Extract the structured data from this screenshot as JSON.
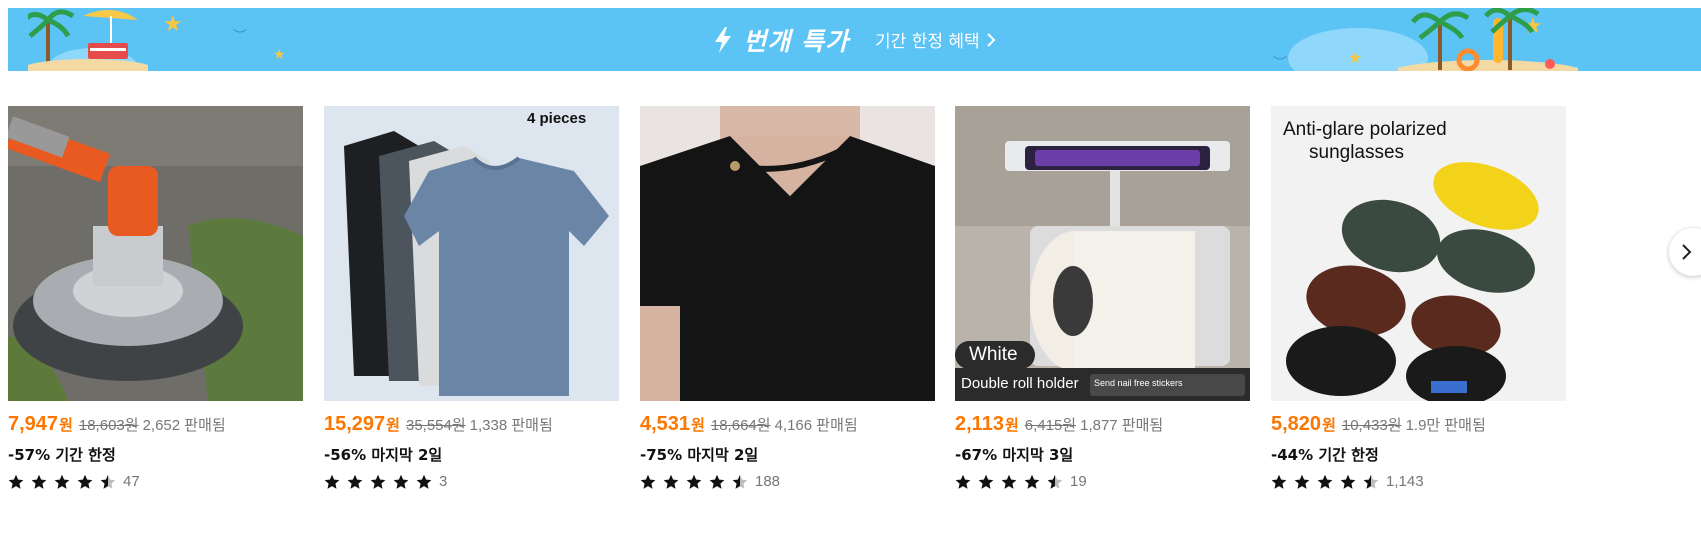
{
  "banner": {
    "title": "번개 특가",
    "subtitle": "기간 한정 혜택",
    "bg_color": "#5cc3f5",
    "icon": "lightning-bolt-icon"
  },
  "products": [
    {
      "price": "7,947",
      "currency": "원",
      "original_price": "18,603원",
      "sold": "2,652 판매됨",
      "promo": "-57% 기간 한정",
      "rating": 4.5,
      "reviews": "47"
    },
    {
      "price": "15,297",
      "currency": "원",
      "original_price": "35,554원",
      "sold": "1,338 판매됨",
      "promo": "-56% 마지막 2일",
      "rating": 5,
      "reviews": "3",
      "image_text": "4 pieces"
    },
    {
      "price": "4,531",
      "currency": "원",
      "original_price": "18,664원",
      "sold": "4,166 판매됨",
      "promo": "-75% 마지막 2일",
      "rating": 4.5,
      "reviews": "188"
    },
    {
      "price": "2,113",
      "currency": "원",
      "original_price": "6,415원",
      "sold": "1,877 판매됨",
      "promo": "-67% 마지막 3일",
      "rating": 4.5,
      "reviews": "19",
      "image_text": "White",
      "image_text2": "Double roll holder",
      "image_text3": "Send nail free stickers"
    },
    {
      "price": "5,820",
      "currency": "원",
      "original_price": "10,433원",
      "sold": "1.9만 판매됨",
      "promo": "-44% 기간 한정",
      "rating": 4.5,
      "reviews": "1,143",
      "image_text": "Anti-glare polarized",
      "image_text2": "sunglasses"
    }
  ],
  "colors": {
    "price": "#fb7701",
    "muted": "#777777"
  },
  "next_icon": "chevron-right-icon"
}
